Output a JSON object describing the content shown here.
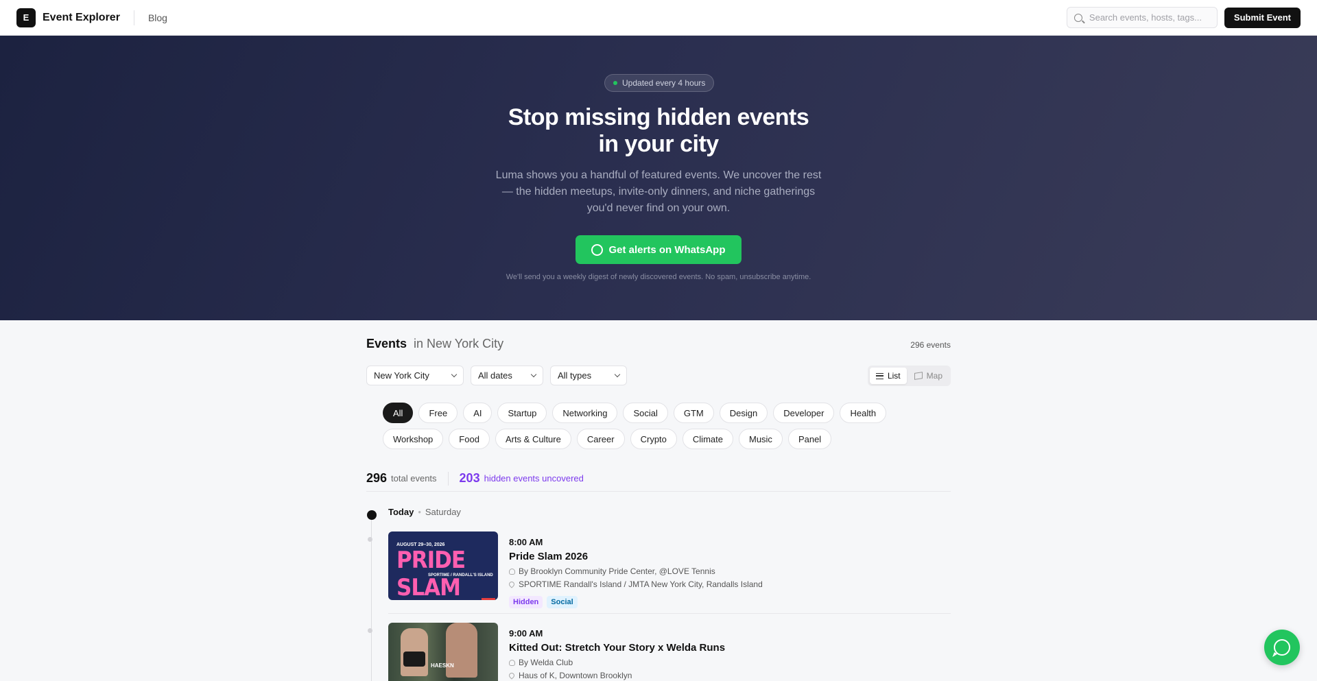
{
  "header": {
    "logo_letter": "E",
    "brand": "Event Explorer",
    "blog": "Blog",
    "search_placeholder": "Search events, hosts, tags...",
    "submit_label": "Submit Event"
  },
  "hero": {
    "pill": "Updated every 4 hours",
    "title_line1": "Stop missing hidden events",
    "title_line2": "in your city",
    "subtitle": "Luma shows you a handful of featured events. We uncover the rest — the hidden meetups, invite-only dinners, and niche gatherings you'd never find on your own.",
    "cta": "Get alerts on WhatsApp",
    "note": "We'll send you a weekly digest of newly discovered events. No spam, unsubscribe anytime."
  },
  "events": {
    "title": "Events",
    "city_suffix": "in New York City",
    "count_label": "296 events",
    "filters": {
      "city": "New York City",
      "dates": "All dates",
      "types": "All types"
    },
    "view": {
      "list": "List",
      "map": "Map"
    },
    "tags": [
      "All",
      "Free",
      "AI",
      "Startup",
      "Networking",
      "Social",
      "GTM",
      "Design",
      "Developer",
      "Health",
      "Workshop",
      "Food",
      "Arts & Culture",
      "Career",
      "Crypto",
      "Climate",
      "Music",
      "Panel"
    ],
    "stats": {
      "total_num": "296",
      "total_label": "total events",
      "hidden_num": "203",
      "hidden_label": "hidden events uncovered"
    },
    "day": {
      "label": "Today",
      "weekday": "Saturday"
    },
    "items": [
      {
        "time": "8:00 AM",
        "title": "Pride Slam 2026",
        "host": "By Brooklyn Community Pride Center, @LOVE Tennis",
        "location": "SPORTIME Randall's Island / JMTA New York City, Randalls Island",
        "badges": [
          "Hidden",
          "Social"
        ],
        "thumb_date": "AUGUST 29–30, 2026",
        "thumb_main": "PRIDE SLAM",
        "thumb_sub": "SPORTIME / RANDALL'S ISLAND"
      },
      {
        "time": "9:00 AM",
        "title": "Kitted Out: Stretch Your Story x Welda Runs",
        "host": "By Welda Club",
        "location": "Haus of K, Downtown Brooklyn",
        "thumb_brand": "HAESKN"
      }
    ]
  },
  "colors": {
    "accent_green": "#22c55e",
    "hidden_purple": "#7c3aed",
    "dark": "#111111"
  }
}
